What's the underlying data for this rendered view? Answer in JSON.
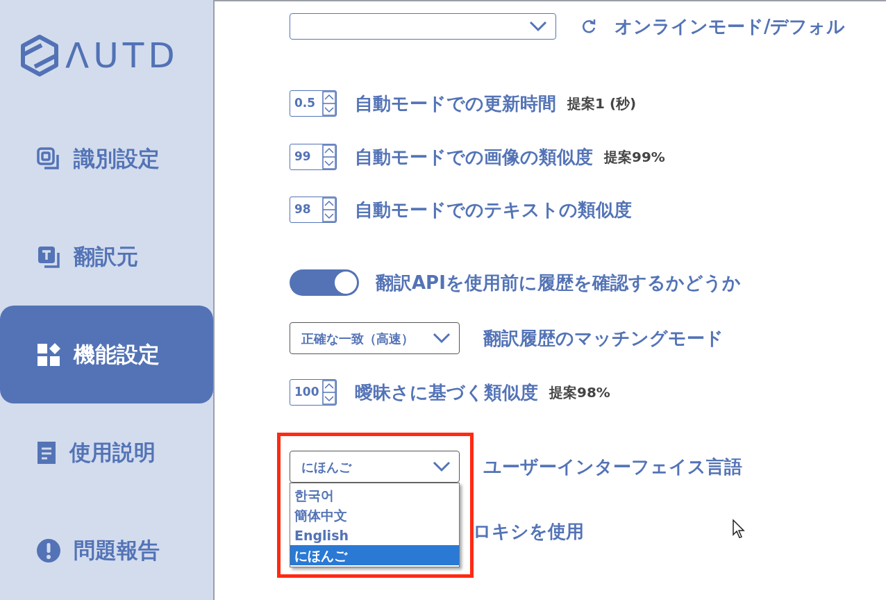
{
  "sidebar": {
    "logo": "ΛUTD",
    "items": [
      {
        "label": "識別設定",
        "kind": "scan",
        "selected": false
      },
      {
        "label": "翻訳元",
        "kind": "text",
        "selected": false
      },
      {
        "label": "機能設定",
        "kind": "grid",
        "selected": true
      },
      {
        "label": "使用説明",
        "kind": "doc",
        "selected": false
      },
      {
        "label": "問題報告",
        "kind": "alert",
        "selected": false
      }
    ]
  },
  "settings": [
    {
      "kind": "select",
      "refresh": true,
      "label": "オンラインモード/デフォル"
    },
    {
      "kind": "spin",
      "value": "0.5",
      "label": "自動モードでの更新時間",
      "hint": "提案1 (秒)"
    },
    {
      "kind": "spin",
      "value": "99",
      "label": "自動モードでの画像の類似度",
      "hint": "提案99%"
    },
    {
      "kind": "spin",
      "value": "98",
      "label": "自動モードでのテキストの類似度"
    },
    {
      "kind": "toggle",
      "on": true,
      "label": "翻訳APIを使用前に履歴を確認するかどうか"
    },
    {
      "kind": "select",
      "value": "正確な一致（高速）",
      "label": "翻訳履歴のマッチングモード"
    },
    {
      "kind": "spin",
      "value": "100",
      "label": "曖昧さに基づく類似度",
      "hint": "提案98%"
    },
    {
      "kind": "select",
      "value": "にほんご",
      "label": "ユーザーインターフェイス言語",
      "highlighted": true,
      "options": [
        {
          "label": "한국어",
          "selected": false
        },
        {
          "label": "簡体中文",
          "selected": false
        },
        {
          "label": "English",
          "selected": false
        },
        {
          "label": "にほんご",
          "selected": true
        }
      ]
    },
    {
      "kind": "text",
      "label": "ロキシを使用"
    }
  ]
}
